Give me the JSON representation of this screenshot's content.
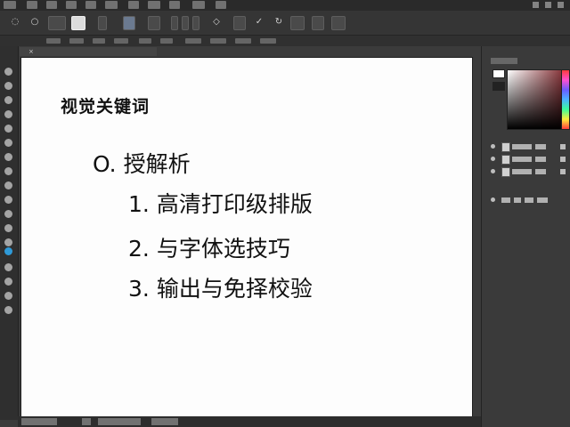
{
  "canvas": {
    "title": "视觉关键词",
    "main_bullet": {
      "marker": "O.",
      "text": "授解析"
    },
    "items": [
      {
        "num": "1.",
        "text": "高清打印级排版"
      },
      {
        "num": "2.",
        "text": "与字体选技巧"
      },
      {
        "num": "3.",
        "text": "输出与免择校验"
      }
    ]
  },
  "colors": {
    "app_bg": "#3b3b3b",
    "canvas_bg": "#fdfdfd",
    "active_tool": "#2f9ad8"
  },
  "icons": {
    "close": "close-icon",
    "visibility": "eye-icon",
    "lock": "lock-icon"
  }
}
